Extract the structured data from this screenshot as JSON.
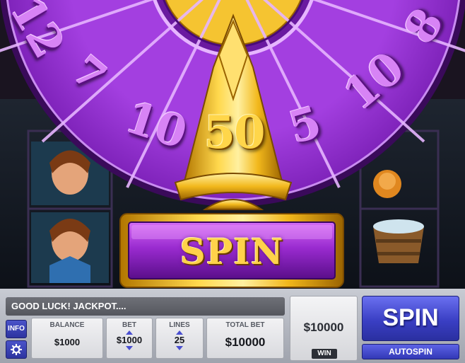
{
  "game": {
    "wheel_numbers_left": [
      "12",
      "7",
      "10"
    ],
    "wheel_numbers_right": [
      "8",
      "10",
      "5"
    ],
    "pointer_value": "50",
    "spin_banner_label": "SPIN"
  },
  "hud": {
    "message": "GOOD LUCK! JACKPOT....",
    "info_label": "INFO",
    "settings_icon": "gear-icon",
    "balance": {
      "title": "BALANCE",
      "value": "$1000"
    },
    "bet": {
      "title": "BET",
      "value": "$1000"
    },
    "lines": {
      "title": "LINES",
      "value": "25"
    },
    "total_bet": {
      "title": "TOTAL BET",
      "value": "$10000"
    },
    "win": {
      "value": "$10000",
      "label": "WIN"
    },
    "spin_label": "SPIN",
    "autospin_label": "AUTOSPIN"
  },
  "colors": {
    "wheel_purple": "#7a1fb5",
    "gold": "#f5c431",
    "hud_blue": "#3a3fc4"
  }
}
